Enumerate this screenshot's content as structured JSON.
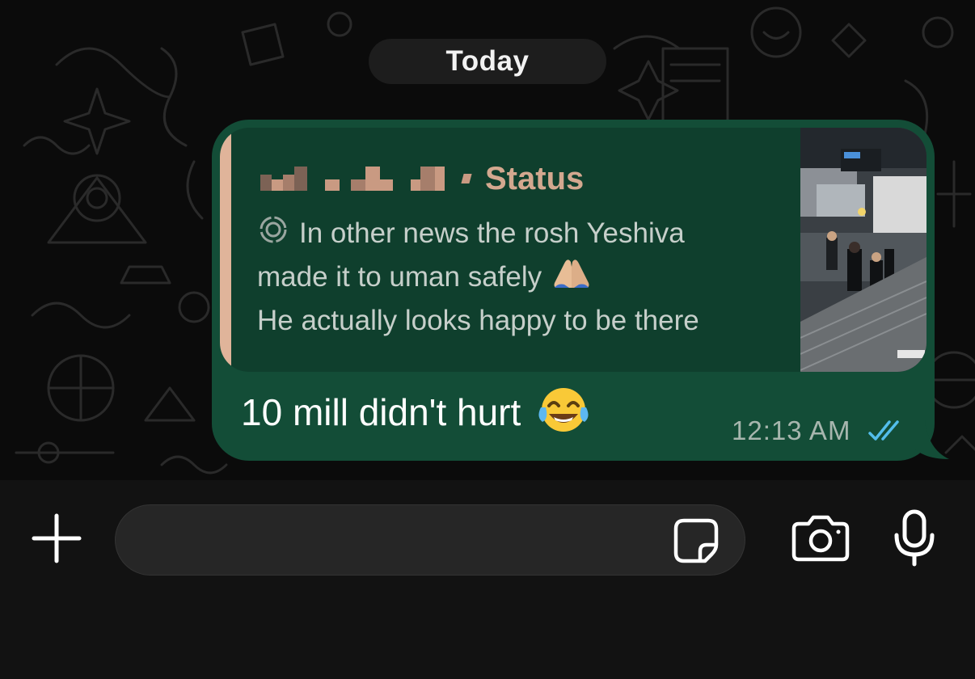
{
  "date_separator": {
    "label": "Today"
  },
  "message": {
    "reply_quote": {
      "status_label": "Status",
      "text_line_1": "In other news the rosh Yeshiva",
      "text_line_2": "made it to uman safely",
      "text_line_3": "He actually looks happy to be there",
      "emoji_name": "folded-hands-emoji",
      "thumbnail_name": "status-thumbnail-image"
    },
    "text": "10 mill didn't hurt",
    "emoji_name": "tears-of-joy-emoji",
    "time": "12:13 AM",
    "read_status": "read",
    "colors": {
      "bubble": "#134d37",
      "quote_background": "#0f3f2d",
      "quote_accent": "#e0b49a",
      "read_ticks": "#53bdeb"
    }
  },
  "composer": {
    "placeholder": "",
    "value": "",
    "icons": [
      "plus-icon",
      "sticker-icon",
      "camera-icon",
      "microphone-icon"
    ]
  }
}
